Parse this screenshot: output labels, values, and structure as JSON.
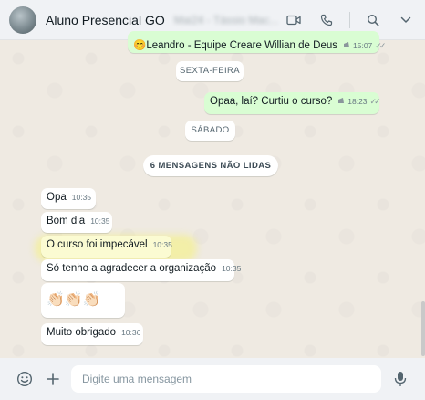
{
  "header": {
    "title": "Aluno Presencial GO",
    "subtitle": "Mai24 - Tássio Mac..."
  },
  "messages": {
    "top_out": {
      "text": "😊Leandro - Equipe Creare Willian de Deus",
      "time": "15:07"
    },
    "date1": "SEXTA-FEIRA",
    "out2": {
      "text": "Opaa, laí? Curtiu o curso?",
      "time": "18:23"
    },
    "date2": "SÁBADO",
    "unread": "6 MENSAGENS NÃO LIDAS",
    "in1": {
      "text": "Opa",
      "time": "10:35"
    },
    "in2": {
      "text": "Bom dia",
      "time": "10:35"
    },
    "in3": {
      "text": "O curso foi impecável",
      "time": "10:35"
    },
    "in4": {
      "text": "Só tenho a agradecer a organização",
      "time": "10:35"
    },
    "in5": {
      "text": "👏🏻👏🏻👏🏻",
      "time": ""
    },
    "in6": {
      "text": "Muito obrigado",
      "time": "10:36"
    }
  },
  "composer": {
    "placeholder": "Digite uma mensagem"
  },
  "icons": {
    "video": "video-call-icon",
    "phone": "phone-icon",
    "search": "search-icon",
    "menu": "chevron-down-icon",
    "emoji": "emoji-icon",
    "attach": "plus-icon",
    "mic": "microphone-icon"
  },
  "colors": {
    "outgoing_bubble": "#d9fdd3",
    "incoming_bubble": "#ffffff",
    "chat_background": "#efeae2",
    "highlight": "#f5f378"
  }
}
